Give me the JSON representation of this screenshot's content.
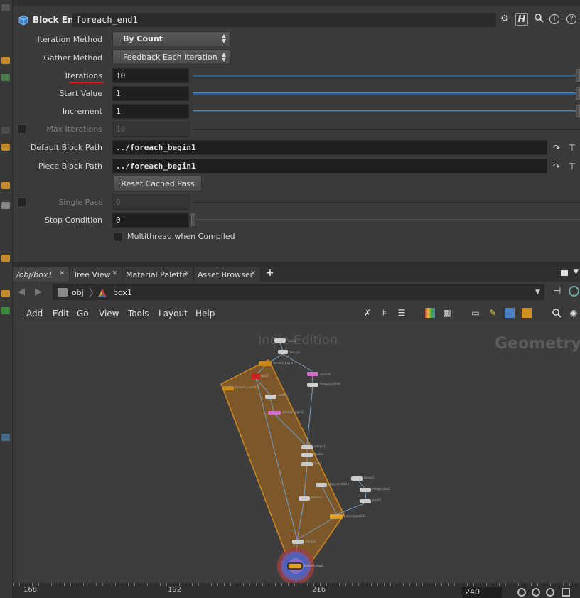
{
  "parameter_editor": {
    "node_type": "Block End",
    "node_name": "foreach_end1",
    "header_icons": [
      "gear-icon",
      "help-h-icon",
      "search-icon",
      "info-icon",
      "help-icon"
    ],
    "iteration_method": {
      "label": "Iteration Method",
      "value": "By Count"
    },
    "gather_method": {
      "label": "Gather Method",
      "value": "Feedback Each Iteration"
    },
    "iterations": {
      "label": "Iterations",
      "value": "10"
    },
    "start_value": {
      "label": "Start Value",
      "value": "1"
    },
    "increment": {
      "label": "Increment",
      "value": "1"
    },
    "max_iterations": {
      "label": "Max Iterations",
      "value": "10",
      "enabled": false
    },
    "default_block_path": {
      "label": "Default Block Path",
      "value": "../foreach_begin1"
    },
    "piece_block_path": {
      "label": "Piece Block Path",
      "value": "../foreach_begin1"
    },
    "reset_cached_pass": "Reset Cached Pass",
    "single_pass": {
      "label": "Single Pass",
      "value": "0",
      "enabled": false
    },
    "stop_condition": {
      "label": "Stop Condition",
      "value": "0"
    },
    "multithread": {
      "label": "Multithread when Compiled",
      "checked": false
    }
  },
  "tabs": [
    {
      "label": "/obj/box1",
      "active": true
    },
    {
      "label": "Tree View",
      "active": false
    },
    {
      "label": "Material Palette",
      "active": false
    },
    {
      "label": "Asset Browser",
      "active": false
    }
  ],
  "path": {
    "segments": [
      "obj",
      "box1"
    ]
  },
  "menu": [
    "Add",
    "Edit",
    "Go",
    "View",
    "Tools",
    "Layout",
    "Help"
  ],
  "network": {
    "watermark": "Indie Edition",
    "context_label": "Geometry",
    "nodes": [
      "box1",
      "foreach_begin1",
      "foreach_count1",
      "box_id",
      "sort1",
      "primtail",
      "foreach_points",
      "scatter",
      "attribwrangle1",
      "merge1",
      "clean1",
      "fuse1",
      "group1",
      "stop_condition",
      "delete1",
      "polyexpand2d1",
      "blast1",
      "merge_box1",
      "merge2",
      "foreach_end1"
    ],
    "colors": {
      "block": "#c98a1d",
      "error": "#d02020",
      "pink": "#d070c8",
      "wire": "#7a9fbf"
    }
  },
  "timeline": {
    "ticks": [
      "168",
      "192",
      "216"
    ],
    "current_frame": "240"
  }
}
